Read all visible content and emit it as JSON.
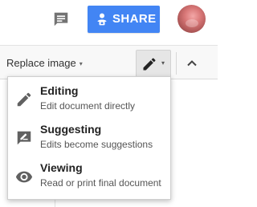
{
  "header": {
    "comments_icon": "comment-bubble-icon",
    "share": {
      "label": "SHARE",
      "icon": "people-lock-icon",
      "color": "#4285f4"
    },
    "avatar_icon": "account-avatar"
  },
  "toolbar": {
    "replace_image_label": "Replace image",
    "dropdown_caret": "▾",
    "mode_icon": "pencil-icon",
    "collapse_icon": "chevron-up-icon"
  },
  "mode_menu": {
    "items": [
      {
        "title": "Editing",
        "description": "Edit document directly",
        "icon": "pencil-icon"
      },
      {
        "title": "Suggesting",
        "description": "Edits become suggestions",
        "icon": "suggest-edit-icon"
      },
      {
        "title": "Viewing",
        "description": "Read or print final document",
        "icon": "eye-icon"
      }
    ]
  }
}
